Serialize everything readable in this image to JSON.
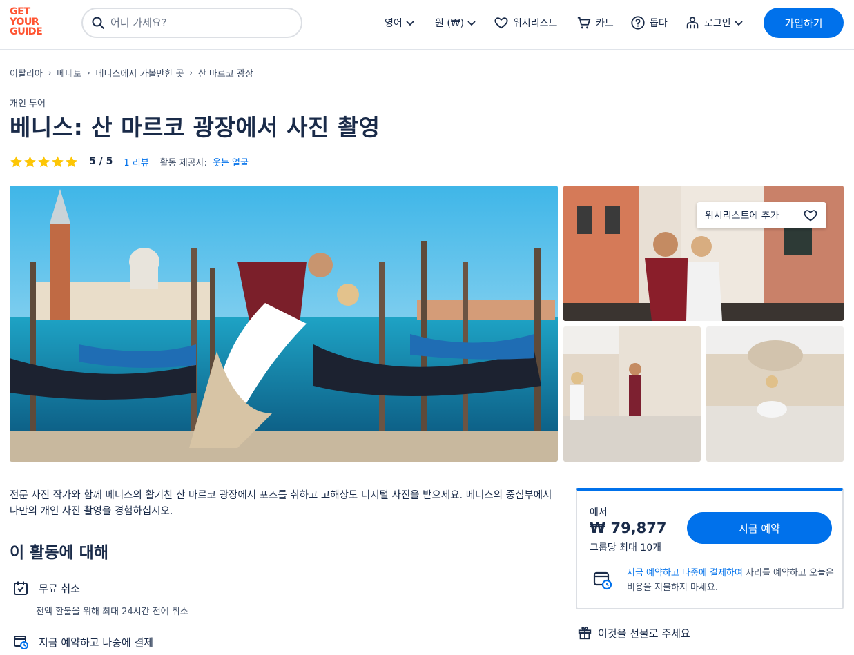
{
  "header": {
    "logo": [
      "GET",
      "YOUR",
      "GUIDE"
    ],
    "search_placeholder": "어디 가세요?",
    "language": "영어",
    "currency": "원 (₩)",
    "wishlist": "위시리스트",
    "cart": "카트",
    "help": "돕다",
    "login": "로그인",
    "signup": "가입하기"
  },
  "breadcrumb": [
    "이탈리아",
    "베네토",
    "베니스에서 가볼만한 곳",
    "산 마르코 광장"
  ],
  "category": "개인 투어",
  "title": "베니스: 산 마르코 광장에서 사진 촬영",
  "rating": {
    "stars": 5,
    "score": "5 / 5",
    "reviews": "1 리뷰",
    "provider_label": "활동 제공자:",
    "provider": "웃는 얼굴"
  },
  "gallery": {
    "wishlist_add": "위시리스트에 추가"
  },
  "description": "전문 사진 작가와 함께 베니스의 활기찬 산 마르코 광장에서 포즈를 취하고 고해상도 디지털 사진을 받으세요. 베니스의 중심부에서 나만의 개인 사진 촬영을 경험하십시오.",
  "about": {
    "title": "이 활동에 대해",
    "features": [
      {
        "label": "무료 취소",
        "sub": "전액 환불을 위해 최대 24시간 전에 취소"
      },
      {
        "label": "지금 예약하고 나중에 결제"
      }
    ]
  },
  "booking": {
    "from": "에서",
    "price": "₩ 79,877",
    "per_group": "그룹당 최대 10개",
    "book_now": "지금 예약",
    "rnpl_link": "지금 예약하고 나중에 결제하여",
    "rnpl_text": " 자리를 예약하고 오늘은 비용을 지불하지 마세요."
  },
  "gift": "이것을 선물로 주세요",
  "colors": {
    "brand": "#ff5533",
    "accent": "#0071eb",
    "star": "#fdc605"
  }
}
